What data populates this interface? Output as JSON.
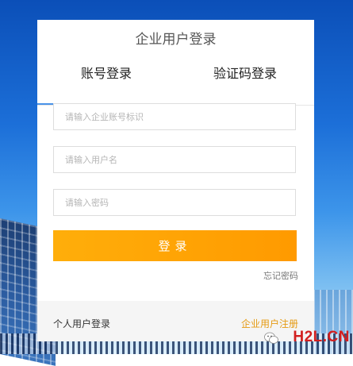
{
  "login": {
    "title": "企业用户登录",
    "tabs": [
      {
        "label": "账号登录",
        "active": true
      },
      {
        "label": "验证码登录",
        "active": false
      }
    ],
    "fields": {
      "enterprise_placeholder": "请输入企业账号标识",
      "username_placeholder": "请输入用户名",
      "password_placeholder": "请输入密码"
    },
    "submit_label": "登录",
    "forgot_password": "忘记密码",
    "footer": {
      "personal_login": "个人用户登录",
      "enterprise_register": "企业用户注册"
    }
  },
  "watermark": {
    "text": "H2L.CN"
  },
  "colors": {
    "accent_orange": "#ff9f00",
    "tab_underline": "#4a93e8",
    "register_link": "#e59a12",
    "watermark": "#d21f1f"
  },
  "icons": [
    "wechat-icon"
  ]
}
